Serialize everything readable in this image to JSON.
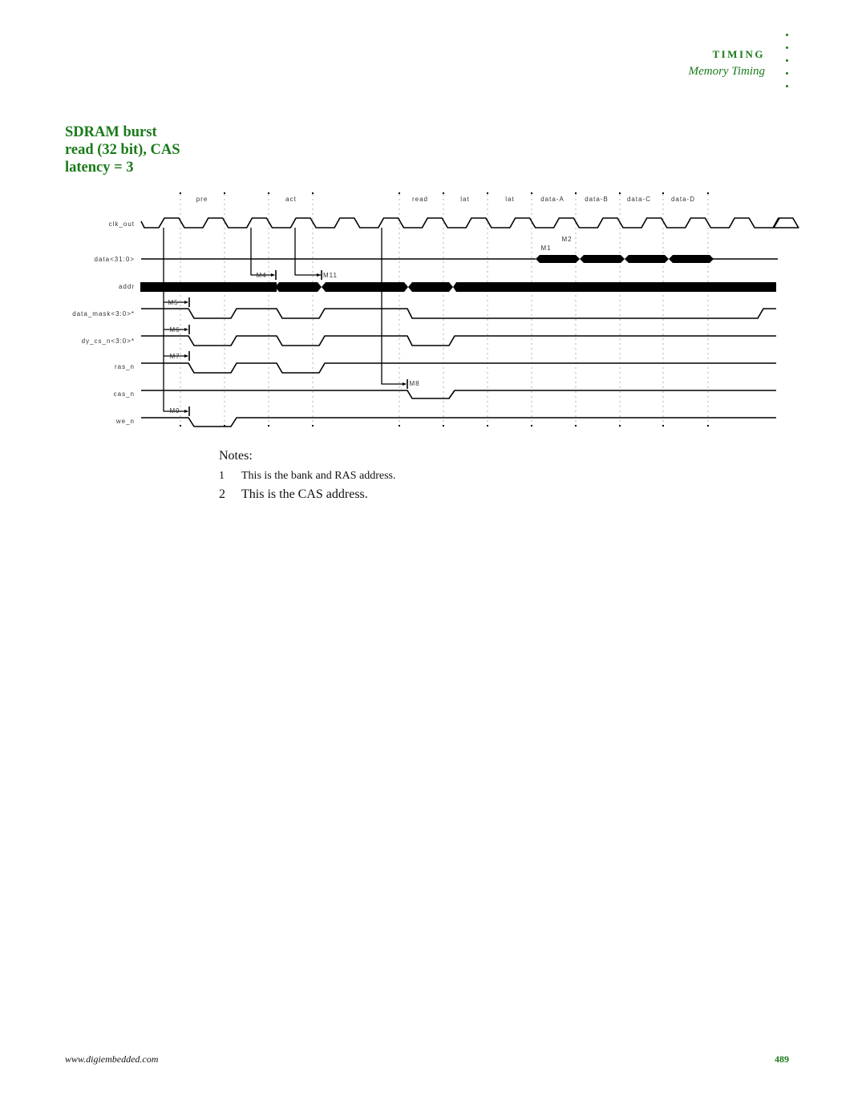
{
  "header": {
    "section": "TIMING",
    "subsection": "Memory Timing"
  },
  "figure": {
    "title": "SDRAM burst read (32 bit), CAS latency = 3",
    "title_lines": [
      "SDRAM burst",
      "read (32 bit), CAS",
      "latency = 3"
    ],
    "phases": [
      "pre",
      "act",
      "read",
      "lat",
      "lat",
      "data-A",
      "data-B",
      "data-C",
      "data-D"
    ],
    "signals": [
      {
        "name": "clk_out",
        "label": "clk_out"
      },
      {
        "name": "data",
        "label": "data<31:0>"
      },
      {
        "name": "addr",
        "label": "addr"
      },
      {
        "name": "data_mask",
        "label": "data_mask<3:0>*"
      },
      {
        "name": "dy_cs_n",
        "label": "dy_cs_n<3:0>*"
      },
      {
        "name": "ras_n",
        "label": "ras_n"
      },
      {
        "name": "cas_n",
        "label": "cas_n"
      },
      {
        "name": "we_n",
        "label": "we_n"
      }
    ],
    "timing_markers": [
      "M1",
      "M2",
      "M4",
      "M11",
      "M5",
      "M6",
      "M7",
      "M8",
      "M9"
    ]
  },
  "notes": {
    "title": "Notes:",
    "items": [
      {
        "num": "1",
        "text": "This is the bank and RAS address."
      },
      {
        "num": "2",
        "text": "This is the CAS address."
      }
    ]
  },
  "footer": {
    "url": "www.digiembedded.com",
    "page": "489"
  },
  "colors": {
    "accent": "#1a7a1a",
    "trace": "#000000",
    "grid": "#aaaaaa"
  }
}
